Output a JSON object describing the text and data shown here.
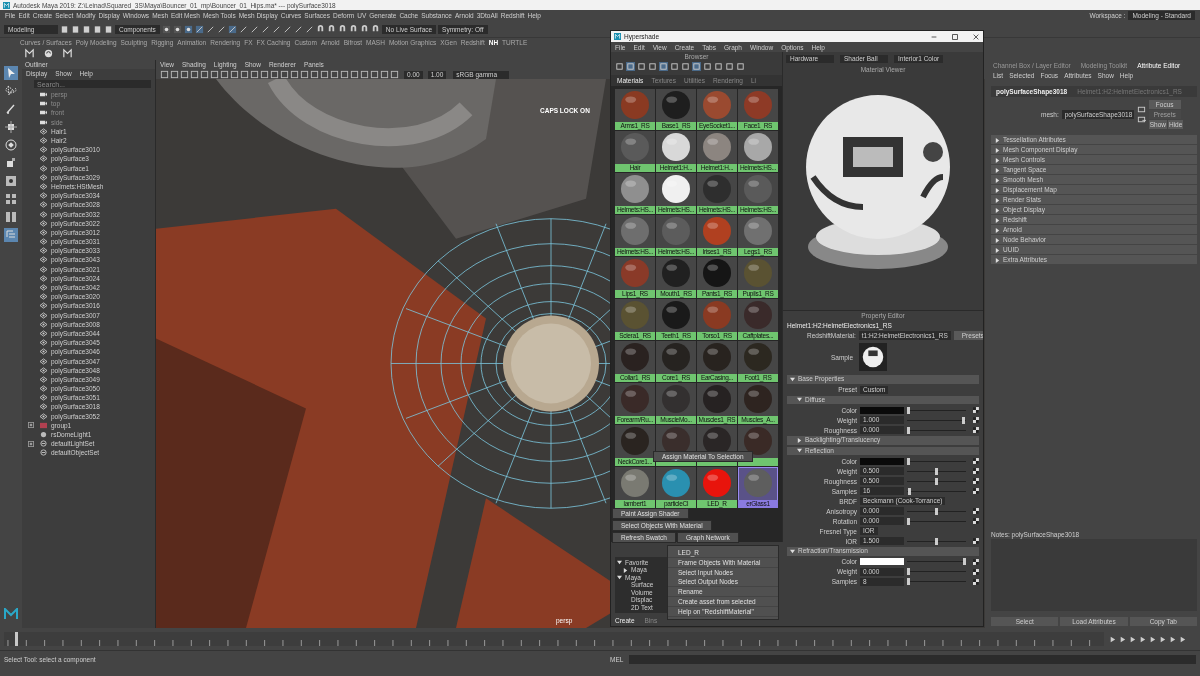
{
  "window": {
    "title": "Autodesk Maya 2019: Z:\\Leinad\\Squared_3S\\Maya\\Bouncer_01_mp\\Bouncer_01_Hips.ma*  ---  polySurface3018"
  },
  "menu_bar": [
    "File",
    "Edit",
    "Create",
    "Select",
    "Modify",
    "Display",
    "Windows",
    "Mesh",
    "Edit Mesh",
    "Mesh Tools",
    "Mesh Display",
    "Curves",
    "Surfaces",
    "Deform",
    "UV",
    "Generate",
    "Cache",
    "Substance",
    "Arnold",
    "3DtoAll",
    "Redshift",
    "Help"
  ],
  "workspace": {
    "label": "Workspace :",
    "value": "Modeling - Standard"
  },
  "toolbar": {
    "mode": "Modeling",
    "components": "Components",
    "live_surface": "No Live Surface",
    "symmetry": "Symmetry: Off"
  },
  "shelf_tabs": [
    {
      "label": "Curves / Surfaces",
      "selected": false
    },
    {
      "label": "Poly Modeling",
      "selected": false
    },
    {
      "label": "Sculpting",
      "selected": false
    },
    {
      "label": "Rigging",
      "selected": false
    },
    {
      "label": "Animation",
      "selected": false
    },
    {
      "label": "Rendering",
      "selected": false
    },
    {
      "label": "FX",
      "selected": false
    },
    {
      "label": "FX Caching",
      "selected": false
    },
    {
      "label": "Custom",
      "selected": false
    },
    {
      "label": "Arnold",
      "selected": false
    },
    {
      "label": "Bifrost",
      "selected": false
    },
    {
      "label": "MASH",
      "selected": false
    },
    {
      "label": "Motion Graphics",
      "selected": false
    },
    {
      "label": "XGen",
      "selected": false
    },
    {
      "label": "Redshift",
      "selected": false
    },
    {
      "label": "NH",
      "selected": true
    },
    {
      "label": "TURTLE",
      "selected": false
    }
  ],
  "toolbox": [
    {
      "kind": "select",
      "selected": true
    },
    {
      "kind": "lasso",
      "selected": false
    },
    {
      "kind": "paint",
      "selected": false
    },
    {
      "kind": "move",
      "selected": false
    },
    {
      "kind": "rotate",
      "selected": false
    },
    {
      "kind": "scale",
      "selected": false
    },
    {
      "kind": "single",
      "selected": false
    },
    {
      "kind": "quad",
      "selected": false
    },
    {
      "kind": "split",
      "selected": false
    },
    {
      "kind": "outliner",
      "selected": true
    }
  ],
  "outliner": {
    "title": "Outliner",
    "menu": [
      "Display",
      "Show",
      "Help"
    ],
    "search_placeholder": "Search...",
    "items": [
      {
        "name": "persp",
        "kind": "camera",
        "hidden": true
      },
      {
        "name": "top",
        "kind": "camera",
        "hidden": true
      },
      {
        "name": "front",
        "kind": "camera",
        "hidden": true
      },
      {
        "name": "side",
        "kind": "camera",
        "hidden": true
      },
      {
        "name": "Hair1",
        "kind": "mesh",
        "hidden": false
      },
      {
        "name": "Hair2",
        "kind": "mesh",
        "hidden": false
      },
      {
        "name": "polySurface3010",
        "kind": "mesh",
        "hidden": false
      },
      {
        "name": "polySurface3",
        "kind": "mesh",
        "hidden": false
      },
      {
        "name": "polySurface1",
        "kind": "mesh",
        "hidden": false
      },
      {
        "name": "polySurface3029",
        "kind": "mesh",
        "hidden": false
      },
      {
        "name": "Helmets:HStMesh",
        "kind": "mesh",
        "hidden": false
      },
      {
        "name": "polySurface3034",
        "kind": "mesh",
        "hidden": false
      },
      {
        "name": "polySurface3028",
        "kind": "mesh",
        "hidden": false
      },
      {
        "name": "polySurface3032",
        "kind": "mesh",
        "hidden": false
      },
      {
        "name": "polySurface3022",
        "kind": "mesh",
        "hidden": false
      },
      {
        "name": "polySurface3012",
        "kind": "mesh",
        "hidden": false
      },
      {
        "name": "polySurface3031",
        "kind": "mesh",
        "hidden": false
      },
      {
        "name": "polySurface3033",
        "kind": "mesh",
        "hidden": false
      },
      {
        "name": "polySurface3043",
        "kind": "mesh",
        "hidden": false
      },
      {
        "name": "polySurface3021",
        "kind": "mesh",
        "hidden": false
      },
      {
        "name": "polySurface3024",
        "kind": "mesh",
        "hidden": false
      },
      {
        "name": "polySurface3042",
        "kind": "mesh",
        "hidden": false
      },
      {
        "name": "polySurface3020",
        "kind": "mesh",
        "hidden": false
      },
      {
        "name": "polySurface3016",
        "kind": "mesh",
        "hidden": false
      },
      {
        "name": "polySurface3007",
        "kind": "mesh",
        "hidden": false
      },
      {
        "name": "polySurface3008",
        "kind": "mesh",
        "hidden": false
      },
      {
        "name": "polySurface3044",
        "kind": "mesh",
        "hidden": false
      },
      {
        "name": "polySurface3045",
        "kind": "mesh",
        "hidden": false
      },
      {
        "name": "polySurface3046",
        "kind": "mesh",
        "hidden": false
      },
      {
        "name": "polySurface3047",
        "kind": "mesh",
        "hidden": false
      },
      {
        "name": "polySurface3048",
        "kind": "mesh",
        "hidden": false
      },
      {
        "name": "polySurface3049",
        "kind": "mesh",
        "hidden": false
      },
      {
        "name": "polySurface3050",
        "kind": "mesh",
        "hidden": false
      },
      {
        "name": "polySurface3051",
        "kind": "mesh",
        "hidden": false
      },
      {
        "name": "polySurface3018",
        "kind": "mesh",
        "hidden": false
      },
      {
        "name": "polySurface3052",
        "kind": "mesh",
        "hidden": false
      },
      {
        "name": "group1",
        "kind": "group",
        "hidden": false
      },
      {
        "name": "rsDomeLight1",
        "kind": "light",
        "hidden": false
      },
      {
        "name": "defaultLightSet",
        "kind": "set",
        "hidden": false
      },
      {
        "name": "defaultObjectSet",
        "kind": "set",
        "hidden": false
      }
    ]
  },
  "viewport": {
    "menu": [
      "View",
      "Shading",
      "Lighting",
      "Show",
      "Renderer",
      "Panels"
    ],
    "exposure": "0.00",
    "gamma": "1.00",
    "color_space": "sRGB gamma",
    "caps_lock": "CAPS LOCK ON",
    "camera": "persp"
  },
  "hypershade": {
    "title": "Hypershade",
    "menu": [
      "File",
      "Edit",
      "View",
      "Create",
      "Tabs",
      "Graph",
      "Window",
      "Options",
      "Help"
    ],
    "browser_title": "Browser",
    "tabs": [
      {
        "label": "Materials",
        "selected": true
      },
      {
        "label": "Textures",
        "selected": false
      },
      {
        "label": "Utilities",
        "selected": false
      },
      {
        "label": "Rendering",
        "selected": false
      },
      {
        "label": "Li",
        "selected": false
      }
    ],
    "swatches": [
      {
        "label": "Arms1_RS",
        "color": "#8a3a22",
        "selected": false
      },
      {
        "label": "Base1_RS",
        "color": "#1e1e1e",
        "selected": false
      },
      {
        "label": "EyeSocket1...",
        "color": "#9a4a30",
        "selected": false
      },
      {
        "label": "Face1_RS",
        "color": "#8e3a26",
        "selected": false
      },
      {
        "label": "Hair",
        "color": "#5a5a5a",
        "selected": false
      },
      {
        "label": "Helmet1:H...",
        "color": "#d8d8d8",
        "selected": false
      },
      {
        "label": "Helmet1:H...",
        "color": "#8c8580",
        "selected": false
      },
      {
        "label": "Helmets:HS...",
        "color": "#a8a8a8",
        "selected": false
      },
      {
        "label": "Helmets:HS...",
        "color": "#8f8f8f",
        "selected": false
      },
      {
        "label": "Helmets:HS...",
        "color": "#f0f0f0",
        "selected": false
      },
      {
        "label": "Helmets:HS...",
        "color": "#2e2e2e",
        "selected": false
      },
      {
        "label": "Helmets:HS...",
        "color": "#5a5a5a",
        "selected": false
      },
      {
        "label": "Helmets:HS...",
        "color": "#6e6e6e",
        "selected": false
      },
      {
        "label": "Helmets:HS...",
        "color": "#5c5c5c",
        "selected": false
      },
      {
        "label": "Irises1_RS",
        "color": "#b04020",
        "selected": false
      },
      {
        "label": "Legs1_RS",
        "color": "#707070",
        "selected": false
      },
      {
        "label": "Lips1_RS",
        "color": "#8a3a28",
        "selected": false
      },
      {
        "label": "Mouth1_RS",
        "color": "#202020",
        "selected": false
      },
      {
        "label": "Pants1_RS",
        "color": "#151515",
        "selected": false
      },
      {
        "label": "Pupils1_RS",
        "color": "#5a5232",
        "selected": false
      },
      {
        "label": "Sclera1_RS",
        "color": "#5a5232",
        "selected": false
      },
      {
        "label": "Teeth1_RS",
        "color": "#1a1a1a",
        "selected": false
      },
      {
        "label": "Torso1_RS",
        "color": "#8a3a22",
        "selected": false
      },
      {
        "label": "Caftplates...",
        "color": "#3a2a2a",
        "selected": false
      },
      {
        "label": "Collar1_RS",
        "color": "#2a2220",
        "selected": false
      },
      {
        "label": "Core1_RS",
        "color": "#262320",
        "selected": false
      },
      {
        "label": "EarCasing...",
        "color": "#28231f",
        "selected": false
      },
      {
        "label": "Foot1_RS",
        "color": "#2c2820",
        "selected": false
      },
      {
        "label": "Forearm/Ru...",
        "color": "#3a2a28",
        "selected": false
      },
      {
        "label": "MuscleMo...",
        "color": "#333030",
        "selected": false
      },
      {
        "label": "Muscles1_RS",
        "color": "#262222",
        "selected": false
      },
      {
        "label": "Muscles_A...",
        "color": "#2e2420",
        "selected": false
      },
      {
        "label": "NeckCore1...",
        "color": "#2a2420",
        "selected": false
      },
      {
        "color": "#3a2e2c",
        "selected": false
      },
      {
        "color": "#2a2626",
        "selected": false
      },
      {
        "color": "#3a2a26",
        "selected": false
      },
      {
        "label": "lambert1",
        "color": "#7a7a72",
        "selected": false
      },
      {
        "label": "particleCl",
        "color": "#2a90b0",
        "selected": false
      },
      {
        "label": "LED_R",
        "color": "#e8140c",
        "selected": false
      },
      {
        "label": "erGlass1",
        "color": "#5e5e5e",
        "selected": true
      }
    ],
    "context_menu": [
      "Assign Material To Selection",
      "Paint Assign Shader",
      "Select Objects With Material",
      "Refresh Swatch",
      "Graph Network"
    ],
    "node_menu": [
      [
        "LED_R"
      ],
      [
        "Frame Objects With Material"
      ],
      [
        "Select Input Nodes",
        "Select Output Nodes"
      ],
      [
        "Rename"
      ],
      [
        "Create asset from selected"
      ],
      [
        "Help on \"RedshiftMaterial\""
      ]
    ],
    "create_panel": {
      "tabs": [
        "Create",
        "Bins"
      ],
      "tree": [
        {
          "label": "Favorite",
          "expanded": true,
          "children": [
            {
              "label": "Maya",
              "expanded": false
            }
          ]
        },
        {
          "label": "Maya",
          "expanded": true,
          "children": [
            {
              "label": "Surface"
            },
            {
              "label": "Volume"
            },
            {
              "label": "Displac"
            },
            {
              "label": "2D Text"
            }
          ]
        }
      ]
    },
    "material_viewer": {
      "title": "Material Viewer",
      "renderer": "Hardware",
      "geometry": "Shader Ball",
      "environment": "Interior1 Color"
    },
    "property_editor": {
      "title": "Property Editor",
      "node": "Helmet1:H2:HelmetElectronics1_RS",
      "type_label": "RedshiftMaterial:",
      "type_value": "t1:H2:HelmetElectronics1_RS",
      "presets": "Presets",
      "sample_label": "Sample",
      "sections": [
        {
          "title": "Base Properties",
          "expanded": true,
          "rows": [
            {
              "kind": "enum",
              "label": "Preset",
              "value": "Custom"
            }
          ]
        },
        {
          "title": "Diffuse",
          "expanded": true,
          "rows": [
            {
              "kind": "color",
              "label": "Color",
              "color": "#0a0a0a",
              "level": 0
            },
            {
              "kind": "number",
              "label": "Weight",
              "value": "1.000",
              "level": 1
            },
            {
              "kind": "number",
              "label": "Roughness",
              "value": "0.000",
              "level": 0
            }
          ]
        },
        {
          "title": "Backlighting/Translucency",
          "expanded": false
        },
        {
          "title": "Reflection",
          "expanded": true,
          "rows": [
            {
              "kind": "color",
              "label": "Color",
              "color": "#0a0a0a",
              "level": 0
            },
            {
              "kind": "number",
              "label": "Weight",
              "value": "0.500",
              "level": 0.5
            },
            {
              "kind": "number",
              "label": "Roughness",
              "value": "0.500",
              "level": 0.5
            },
            {
              "kind": "number",
              "label": "Samples",
              "value": "16",
              "level": 0.03
            },
            {
              "kind": "enum",
              "label": "BRDF",
              "value": "Beckmann (Cook-Torrance)"
            },
            {
              "kind": "number",
              "label": "Anisotropy",
              "value": "0.000",
              "level": 0.5
            },
            {
              "kind": "number",
              "label": "Rotation",
              "value": "0.000",
              "level": 0
            },
            {
              "kind": "enum",
              "label": "Fresnel Type",
              "value": "IOR"
            },
            {
              "kind": "number",
              "label": "IOR",
              "value": "1.500",
              "level": 0.5
            }
          ]
        },
        {
          "title": "Refraction/Transmission",
          "expanded": true,
          "rows": [
            {
              "kind": "color",
              "label": "Color",
              "color": "#ffffff",
              "level": 1
            },
            {
              "kind": "number",
              "label": "Weight",
              "value": "0.000",
              "level": 0
            },
            {
              "kind": "number",
              "label": "Samples",
              "value": "8",
              "level": 0.01
            }
          ]
        }
      ]
    }
  },
  "attribute_panel": {
    "tabs": [
      {
        "label": "Channel Box / Layer Editor",
        "selected": false
      },
      {
        "label": "Modeling Toolkit",
        "selected": false
      },
      {
        "label": "Attribute Editor",
        "selected": true
      }
    ],
    "menu": [
      "List",
      "Selected",
      "Focus",
      "Attributes",
      "Show",
      "Help"
    ],
    "node_tabs": [
      {
        "label": "polySurfaceShape3018",
        "selected": true
      },
      {
        "label": "Helmet1:H2:HelmetElectronics1_RS",
        "selected": false
      }
    ],
    "mesh_label": "mesh:",
    "mesh_value": "polySurfaceShape3018",
    "buttons": [
      {
        "label": "Focus",
        "disabled": false
      },
      {
        "label": "Presets",
        "disabled": true
      },
      {
        "label": "Show",
        "disabled": false
      },
      {
        "label": "Hide",
        "disabled": false
      }
    ],
    "sections": [
      "Tessellation Attributes",
      "Mesh Component Display",
      "Mesh Controls",
      "Tangent Space",
      "Smooth Mesh",
      "Displacement Map",
      "Render Stats",
      "Object Display",
      "Redshift",
      "Arnold",
      "Node Behavior",
      "UUID",
      "Extra Attributes"
    ],
    "notes": "Notes:  polySurfaceShape3018",
    "bottom_buttons": [
      "Select",
      "Load Attributes",
      "Copy Tab"
    ]
  },
  "time_slider": {
    "level": 0.01
  },
  "command_line": {
    "language": "MEL",
    "help": "Select Tool: select a component"
  }
}
